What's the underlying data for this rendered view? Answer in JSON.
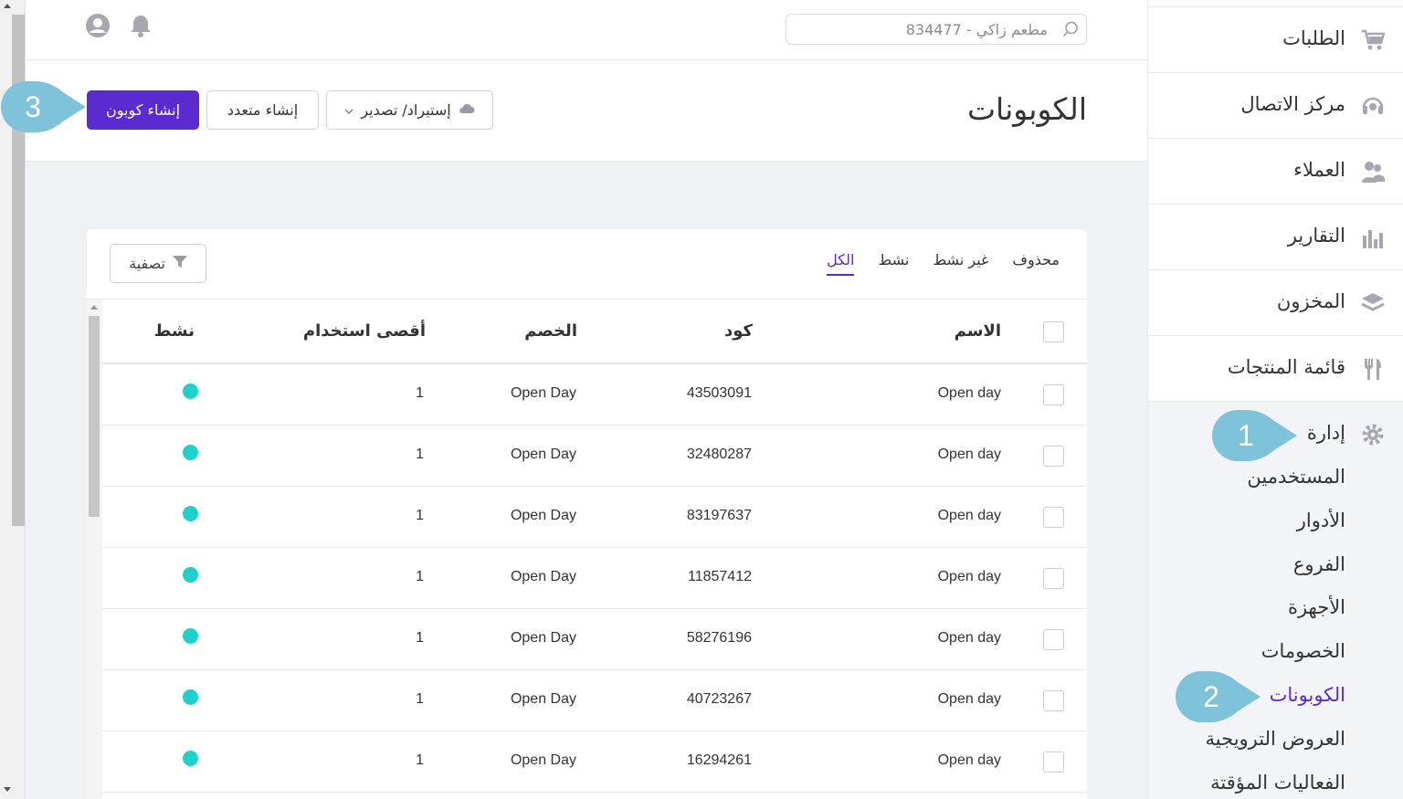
{
  "header": {
    "search_placeholder": "مطعم زاكي - 834477",
    "icons": [
      "bell-icon",
      "user-avatar-icon",
      "search-icon"
    ]
  },
  "page": {
    "title": "الكوبونات",
    "buttons": {
      "import_export": "إستيراد/ تصدير",
      "create_multiple": "إنشاء متعدد",
      "create_coupon": "إنشاء كوبون"
    }
  },
  "tabs": {
    "all": "الكل",
    "active": "نشط",
    "inactive": "غير نشط",
    "deleted": "محذوف"
  },
  "filter_label": "تصفية",
  "table": {
    "columns": {
      "name": "الاسم",
      "code": "كود",
      "discount": "الخصم",
      "max_uses": "أقصى استخدام",
      "active": "نشط"
    },
    "rows": [
      {
        "name": "Open day",
        "code": "43503091",
        "discount": "Open Day",
        "max_uses": "1"
      },
      {
        "name": "Open day",
        "code": "32480287",
        "discount": "Open Day",
        "max_uses": "1"
      },
      {
        "name": "Open day",
        "code": "83197637",
        "discount": "Open Day",
        "max_uses": "1"
      },
      {
        "name": "Open day",
        "code": "11857412",
        "discount": "Open Day",
        "max_uses": "1"
      },
      {
        "name": "Open day",
        "code": "58276196",
        "discount": "Open Day",
        "max_uses": "1"
      },
      {
        "name": "Open day",
        "code": "40723267",
        "discount": "Open Day",
        "max_uses": "1"
      },
      {
        "name": "Open day",
        "code": "16294261",
        "discount": "Open Day",
        "max_uses": "1"
      }
    ],
    "active_color": "#1fd1cd"
  },
  "sidebar": {
    "items": [
      {
        "label": "الطلبات",
        "icon": "cart-icon"
      },
      {
        "label": "مركز الاتصال",
        "icon": "headset-icon"
      },
      {
        "label": "العملاء",
        "icon": "customers-icon"
      },
      {
        "label": "التقارير",
        "icon": "bar-chart-icon"
      },
      {
        "label": "المخزون",
        "icon": "layers-icon"
      },
      {
        "label": "قائمة المنتجات",
        "icon": "fork-knife-icon"
      }
    ],
    "admin": {
      "label": "إدارة",
      "icon": "gear-icon",
      "sub_items": [
        "المستخدمين",
        "الأدوار",
        "الفروع",
        "الأجهزة",
        "الخصومات",
        "الكوبونات",
        "العروض الترويجية",
        "الفعاليات المؤقتة"
      ],
      "active_sub": "الكوبونات"
    }
  },
  "callouts": [
    "1",
    "2",
    "3"
  ],
  "colors": {
    "accent": "#5b2bd0",
    "callout": "#7ec3da"
  }
}
